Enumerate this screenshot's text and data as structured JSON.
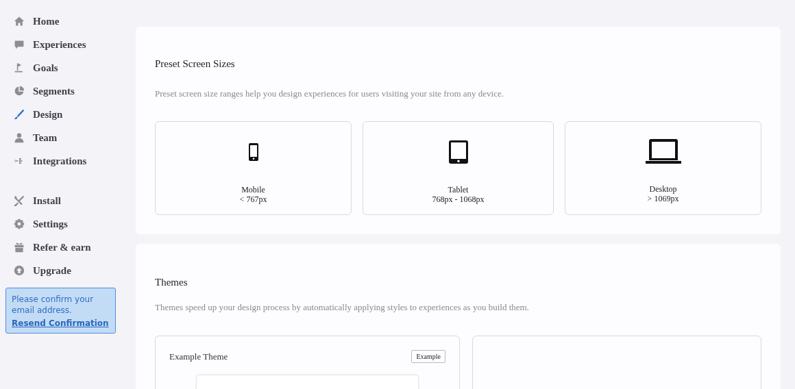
{
  "sidebar": {
    "nav_main": [
      {
        "label": "Home",
        "selected": false
      },
      {
        "label": "Experiences",
        "selected": false
      },
      {
        "label": "Goals",
        "selected": false
      },
      {
        "label": "Segments",
        "selected": false
      },
      {
        "label": "Design",
        "selected": true
      },
      {
        "label": "Team",
        "selected": false
      },
      {
        "label": "Integrations",
        "selected": false
      }
    ],
    "nav_secondary": [
      {
        "label": "Install",
        "selected": false
      },
      {
        "label": "Settings",
        "selected": false
      },
      {
        "label": "Refer & earn",
        "selected": false
      },
      {
        "label": "Upgrade",
        "selected": false
      }
    ],
    "notice": {
      "message": "Please confirm your email address.",
      "link": "Resend Confirmation"
    }
  },
  "preset_screen_sizes": {
    "title": "Preset Screen Sizes",
    "description": "Preset screen size ranges help you design experiences for users visiting your site from any device.",
    "devices": [
      {
        "name": "Mobile",
        "range": "< 767px"
      },
      {
        "name": "Tablet",
        "range": "768px - 1068px"
      },
      {
        "name": "Desktop",
        "range": "> 1069px"
      }
    ]
  },
  "themes": {
    "title": "Themes",
    "description": "Themes speed up your design process by automatically applying styles to experiences as you build them.",
    "cards": [
      {
        "name": "Example Theme",
        "tag": "Example"
      }
    ]
  }
}
